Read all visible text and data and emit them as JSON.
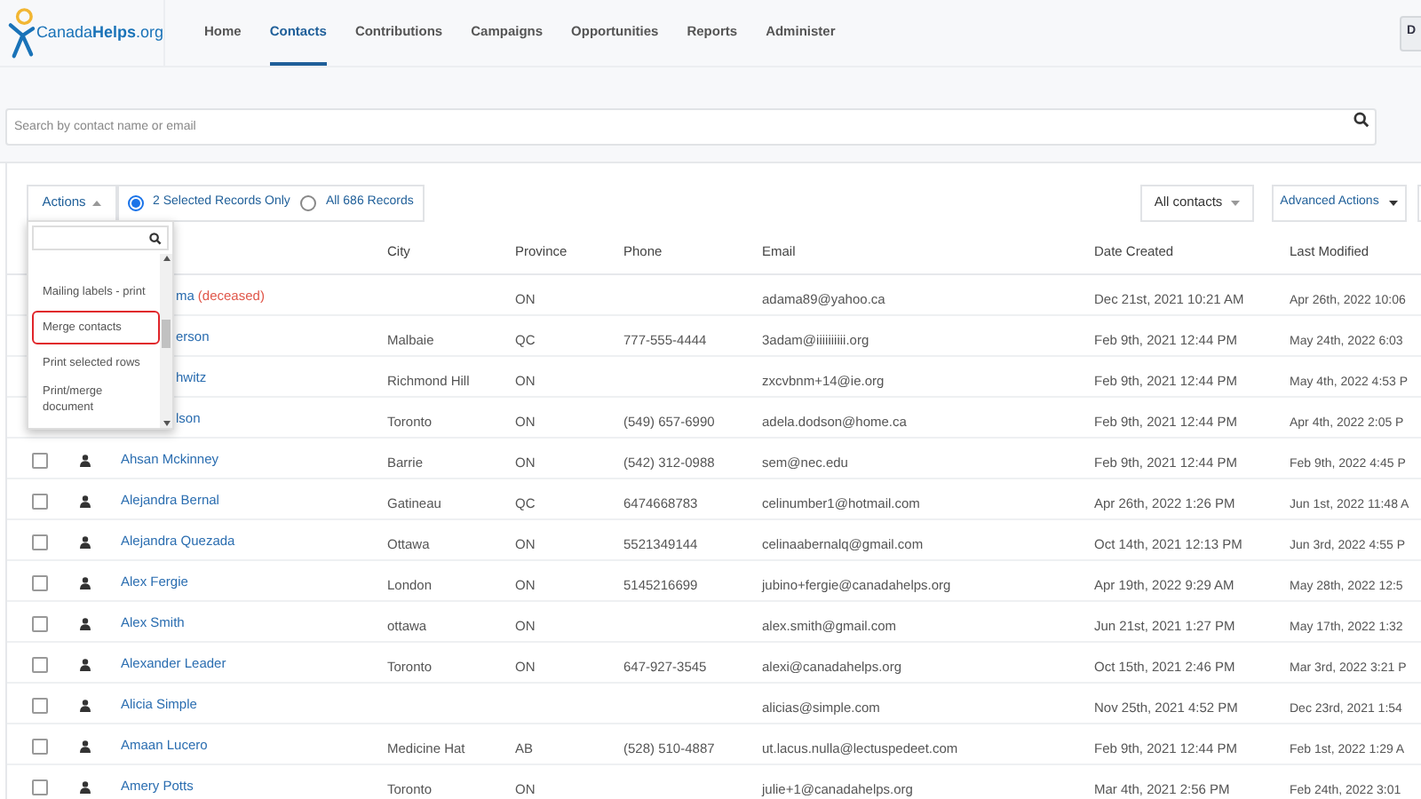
{
  "logo": "Canada**Helps**.org",
  "nav": [
    {
      "label": "Home",
      "selected": false
    },
    {
      "label": "Contacts",
      "selected": true
    },
    {
      "label": "Contributions",
      "selected": false
    },
    {
      "label": "Campaigns",
      "selected": false
    },
    {
      "label": "Opportunities",
      "selected": false
    },
    {
      "label": "Reports",
      "selected": false
    },
    {
      "label": "Administer",
      "selected": false
    }
  ],
  "header_button": "D",
  "search": {
    "placeholder": "Search by contact name or email"
  },
  "toolbar": {
    "actions": "Actions",
    "scope": [
      {
        "label": "2 Selected Records Only",
        "selected": true
      },
      {
        "label": "All 686 Records",
        "selected": false
      }
    ],
    "filter": "All contacts",
    "advanced": "Advanced Actions"
  },
  "menu": {
    "items": [
      {
        "label": "Mailing labels - print",
        "highlighted": false
      },
      {
        "label": "Merge contacts",
        "highlighted": true
      },
      {
        "label": "Print selected rows",
        "highlighted": false
      },
      {
        "label": "Print/merge document",
        "highlighted": false
      }
    ]
  },
  "table": {
    "columns": [
      "City",
      "Province",
      "Phone",
      "Email",
      "Date Created",
      "Last Modified"
    ],
    "rows": [
      {
        "partly_covered": true,
        "name": "ma",
        "note": "(deceased)",
        "city": "",
        "province": "ON",
        "phone": "",
        "email": "adama89@yahoo.ca",
        "created": "Dec 21st, 2021 10:21 AM",
        "modified": "Apr 26th, 2022 10:06"
      },
      {
        "partly_covered": true,
        "name": "erson",
        "city": "Malbaie",
        "province": "QC",
        "phone": "777-555-4444",
        "email": "3adam@iiiiiiiiii.org",
        "created": "Feb 9th, 2021 12:44 PM",
        "modified": "May 24th, 2022 6:03"
      },
      {
        "partly_covered": true,
        "name": "hwitz",
        "city": "Richmond Hill",
        "province": "ON",
        "phone": "",
        "email": "zxcvbnm+14@ie.org",
        "created": "Feb 9th, 2021 12:44 PM",
        "modified": "May 4th, 2022 4:53 P"
      },
      {
        "partly_covered": true,
        "name": "lson",
        "city": "Toronto",
        "province": "ON",
        "phone": "(549) 657-6990",
        "email": "adela.dodson@home.ca",
        "created": "Feb 9th, 2021 12:44 PM",
        "modified": "Apr 4th, 2022 2:05 P"
      },
      {
        "partly_covered": false,
        "checked": false,
        "name": "Ahsan Mckinney",
        "city": "Barrie",
        "province": "ON",
        "phone": "(542) 312-0988",
        "email": "sem@nec.edu",
        "created": "Feb 9th, 2021 12:44 PM",
        "modified": "Feb 9th, 2022 4:45 P"
      },
      {
        "partly_covered": false,
        "checked": false,
        "name": "Alejandra Bernal",
        "city": "Gatineau",
        "province": "QC",
        "phone": "6474668783",
        "email": "celinumber1@hotmail.com",
        "created": "Apr 26th, 2022 1:26 PM",
        "modified": "Jun 1st, 2022 11:48 A"
      },
      {
        "partly_covered": false,
        "checked": false,
        "name": "Alejandra Quezada",
        "city": "Ottawa",
        "province": "ON",
        "phone": "5521349144",
        "email": "celinaabernalq@gmail.com",
        "created": "Oct 14th, 2021 12:13 PM",
        "modified": "Jun 3rd, 2022 4:55 P"
      },
      {
        "partly_covered": false,
        "checked": false,
        "name": "Alex Fergie",
        "city": "London",
        "province": "ON",
        "phone": "5145216699",
        "email": "jubino+fergie@canadahelps.org",
        "created": "Apr 19th, 2022 9:29 AM",
        "modified": "May 28th, 2022 12:5"
      },
      {
        "partly_covered": false,
        "checked": false,
        "name": "Alex Smith",
        "city": "ottawa",
        "province": "ON",
        "phone": "",
        "email": "alex.smith@gmail.com",
        "created": "Jun 21st, 2021 1:27 PM",
        "modified": "May 17th, 2022 1:32"
      },
      {
        "partly_covered": false,
        "checked": false,
        "name": "Alexander Leader",
        "city": "Toronto",
        "province": "ON",
        "phone": "647-927-3545",
        "email": "alexi@canadahelps.org",
        "created": "Oct 15th, 2021 2:46 PM",
        "modified": "Mar 3rd, 2022 3:21 P"
      },
      {
        "partly_covered": false,
        "checked": false,
        "name": "Alicia Simple",
        "city": "",
        "province": "",
        "phone": "",
        "email": "alicias@simple.com",
        "created": "Nov 25th, 2021 4:52 PM",
        "modified": "Dec 23rd, 2021 1:54"
      },
      {
        "partly_covered": false,
        "checked": false,
        "name": "Amaan Lucero",
        "city": "Medicine Hat",
        "province": "AB",
        "phone": "(528) 510-4887",
        "email": "ut.lacus.nulla@lectuspedeet.com",
        "created": "Feb 9th, 2021 12:44 PM",
        "modified": "Feb 1st, 2022 1:29 A"
      },
      {
        "partly_covered": false,
        "checked": false,
        "name": "Amery Potts",
        "city": "Toronto",
        "province": "ON",
        "phone": "",
        "email": "julie+1@canadahelps.org",
        "created": "Mar 4th, 2021 2:56 PM",
        "modified": "Feb 24th, 2022 3:01"
      }
    ]
  }
}
